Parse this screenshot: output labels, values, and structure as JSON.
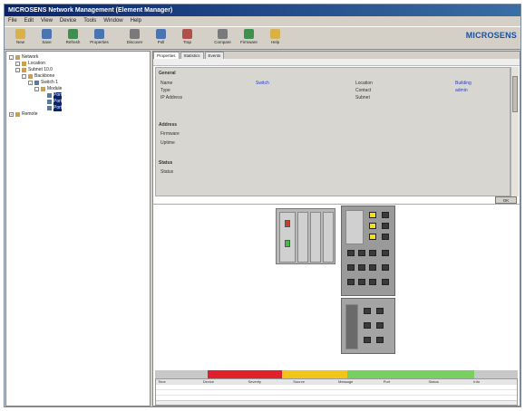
{
  "window": {
    "title": "MICROSENS Network Management (Element Manager)"
  },
  "menu": [
    "File",
    "Edit",
    "View",
    "Device",
    "Tools",
    "Window",
    "Help"
  ],
  "toolbar": {
    "buttons": [
      {
        "label": "New",
        "icon": "new-icon",
        "color": "#d9b14a"
      },
      {
        "label": "Save",
        "icon": "save-icon",
        "color": "#4a74b0"
      },
      {
        "label": "Refresh",
        "icon": "refresh-icon",
        "color": "#3f8f4f"
      },
      {
        "label": "Properties",
        "icon": "properties-icon",
        "color": "#4a74b0"
      },
      {
        "label": "Discover",
        "icon": "discover-icon",
        "color": "#7a7a7a"
      },
      {
        "label": "Poll",
        "icon": "poll-icon",
        "color": "#4a74b0"
      },
      {
        "label": "Trap",
        "icon": "trap-icon",
        "color": "#b0504a"
      },
      {
        "label": "Compare",
        "icon": "compare-icon",
        "color": "#7a7a7a"
      },
      {
        "label": "Firmware",
        "icon": "firmware-icon",
        "color": "#3f8f4f"
      },
      {
        "label": "Help",
        "icon": "help-icon",
        "color": "#d9b14a"
      }
    ],
    "logo": "MICROSENS"
  },
  "tree": [
    {
      "label": "Network",
      "indent": 0,
      "expander": "-",
      "icon": "folder"
    },
    {
      "label": "Location",
      "indent": 1,
      "expander": "-",
      "icon": "folder"
    },
    {
      "label": "Subnet 10.0",
      "indent": 1,
      "expander": "-",
      "icon": "folder"
    },
    {
      "label": "Backbone",
      "indent": 2,
      "expander": "-",
      "icon": "folder"
    },
    {
      "label": "Switch 1",
      "indent": 3,
      "expander": "-",
      "icon": "device"
    },
    {
      "label": "Module",
      "indent": 4,
      "expander": "-",
      "icon": "folder"
    },
    {
      "label": "Port",
      "indent": 5,
      "expander": "",
      "icon": "device",
      "selected": true
    },
    {
      "label": "Port",
      "indent": 5,
      "expander": "",
      "icon": "device",
      "selected": true
    },
    {
      "label": "Port",
      "indent": 5,
      "expander": "",
      "icon": "device",
      "selected": true
    },
    {
      "label": "Remote",
      "indent": 0,
      "expander": "+",
      "icon": "folder"
    }
  ],
  "tabs": [
    "Properties",
    "Statistics",
    "Events"
  ],
  "infostrip": "",
  "properties": {
    "sections": [
      "General",
      "Address",
      "Status"
    ],
    "rows": [
      {
        "label": "Name",
        "value": "Switch",
        "label2": "Location",
        "value2": "Building"
      },
      {
        "label": "Type",
        "value": "",
        "label2": "Contact",
        "value2": "admin"
      },
      {
        "label": "IP Address",
        "value": "",
        "label2": "Subnet",
        "value2": ""
      },
      {
        "label": "Firmware",
        "value": "",
        "label2": "",
        "value2": ""
      },
      {
        "label": "Uptime",
        "value": "",
        "label2": "",
        "value2": ""
      },
      {
        "label": "Status",
        "value": "",
        "label2": "",
        "value2": ""
      }
    ],
    "ok_label": "OK"
  },
  "alarm_bar": [
    {
      "label": "",
      "color": "#c8c8c8"
    },
    {
      "label": "",
      "color": "#e0202a"
    },
    {
      "label": "",
      "color": "#f2c618"
    },
    {
      "label": "",
      "color": "#78d060"
    },
    {
      "label": "",
      "color": "#c8c8c8"
    }
  ],
  "events": {
    "columns": [
      "Time",
      "Device",
      "Severity",
      "Source",
      "Message",
      "Port",
      "Status",
      "Info"
    ],
    "rows": [
      [
        "",
        "",
        "",
        "",
        "",
        "",
        "",
        ""
      ],
      [
        "",
        "",
        "",
        "",
        "",
        "",
        "",
        ""
      ],
      [
        "",
        "",
        "",
        "",
        "",
        "",
        "",
        ""
      ]
    ]
  }
}
